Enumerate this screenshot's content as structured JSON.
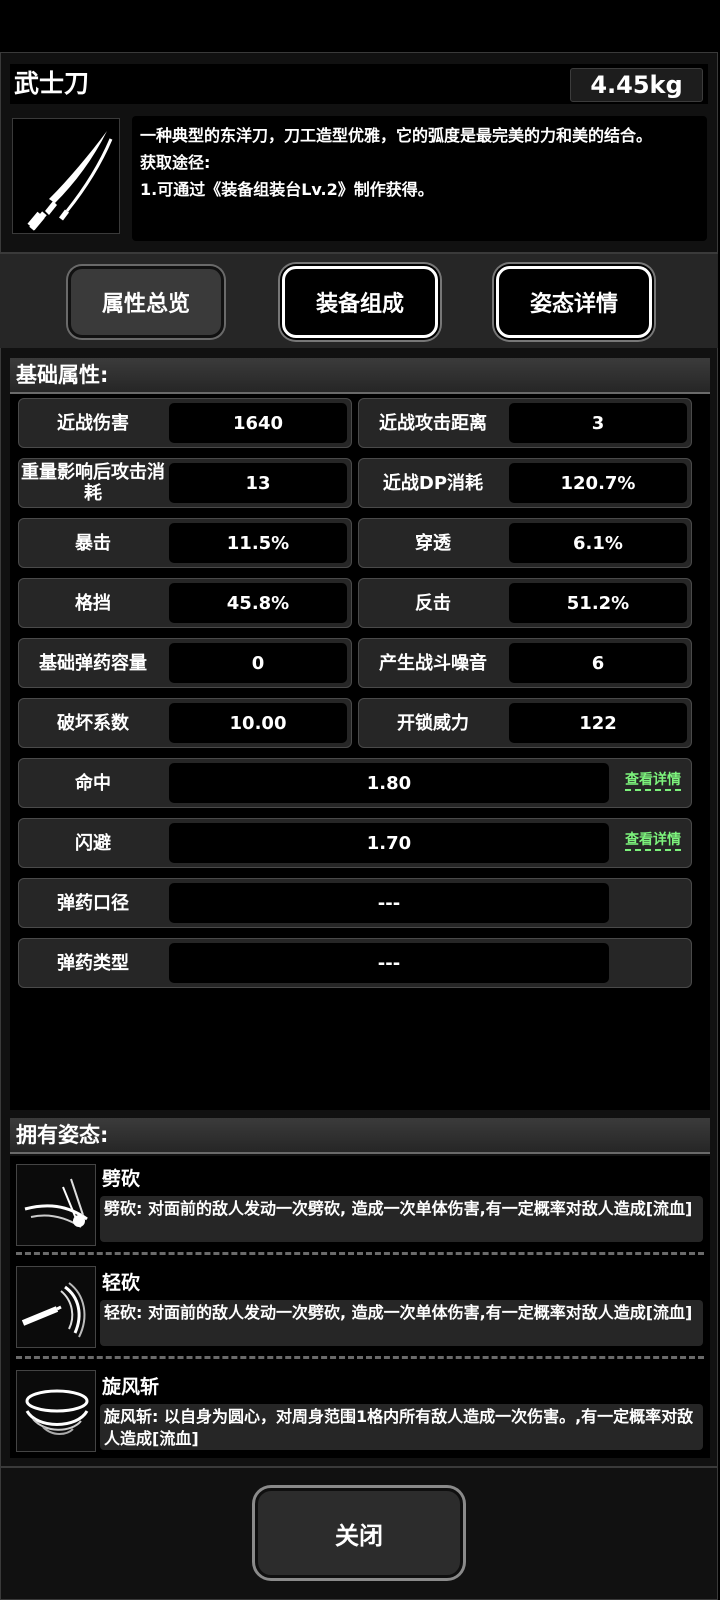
{
  "item": {
    "name": "武士刀",
    "weight": "4.45kg",
    "icon": "katana-icon",
    "description": "一种典型的东洋刀，刀工造型优雅，它的弧度是最完美的力和美的结合。\n获取途径:\n1.可通过《装备组装台Lv.2》制作获得。"
  },
  "tabs": [
    {
      "label": "属性总览",
      "active": true
    },
    {
      "label": "装备组成",
      "active": false
    },
    {
      "label": "姿态详情",
      "active": false
    }
  ],
  "base": {
    "heading": "基础属性:",
    "pairs": [
      {
        "left": {
          "label": "近战伤害",
          "value": "1640"
        },
        "right": {
          "label": "近战攻击距离",
          "value": "3"
        }
      },
      {
        "left": {
          "label": "重量影响后攻击消耗",
          "value": "13"
        },
        "right": {
          "label": "近战DP消耗",
          "value": "120.7%"
        }
      },
      {
        "left": {
          "label": "暴击",
          "value": "11.5%"
        },
        "right": {
          "label": "穿透",
          "value": "6.1%"
        }
      },
      {
        "left": {
          "label": "格挡",
          "value": "45.8%"
        },
        "right": {
          "label": "反击",
          "value": "51.2%"
        }
      },
      {
        "left": {
          "label": "基础弹药容量",
          "value": "0"
        },
        "right": {
          "label": "产生战斗噪音",
          "value": "6"
        }
      },
      {
        "left": {
          "label": "破坏系数",
          "value": "10.00"
        },
        "right": {
          "label": "开锁威力",
          "value": "122"
        }
      }
    ],
    "full": [
      {
        "label": "命中",
        "value": "1.80",
        "link": "查看详情"
      },
      {
        "label": "闪避",
        "value": "1.70",
        "link": "查看详情"
      },
      {
        "label": "弹药口径",
        "value": "---"
      },
      {
        "label": "弹药类型",
        "value": "---"
      }
    ]
  },
  "stances": {
    "heading": "拥有姿态:",
    "items": [
      {
        "name": "劈砍",
        "icon": "slash-icon",
        "desc": "劈砍: 对面前的敌人发动一次劈砍, 造成一次单体伤害,有一定概率对敌人造成[流血]"
      },
      {
        "name": "轻砍",
        "icon": "light-slash-icon",
        "desc": "轻砍: 对面前的敌人发动一次劈砍, 造成一次单体伤害,有一定概率对敌人造成[流血]"
      },
      {
        "name": "旋风斩",
        "icon": "whirlwind-icon",
        "desc": "旋风斩: 以自身为圆心，对周身范围1格内所有敌人造成一次伤害。,有一定概率对敌人造成[流血]"
      }
    ]
  },
  "close_label": "关闭"
}
